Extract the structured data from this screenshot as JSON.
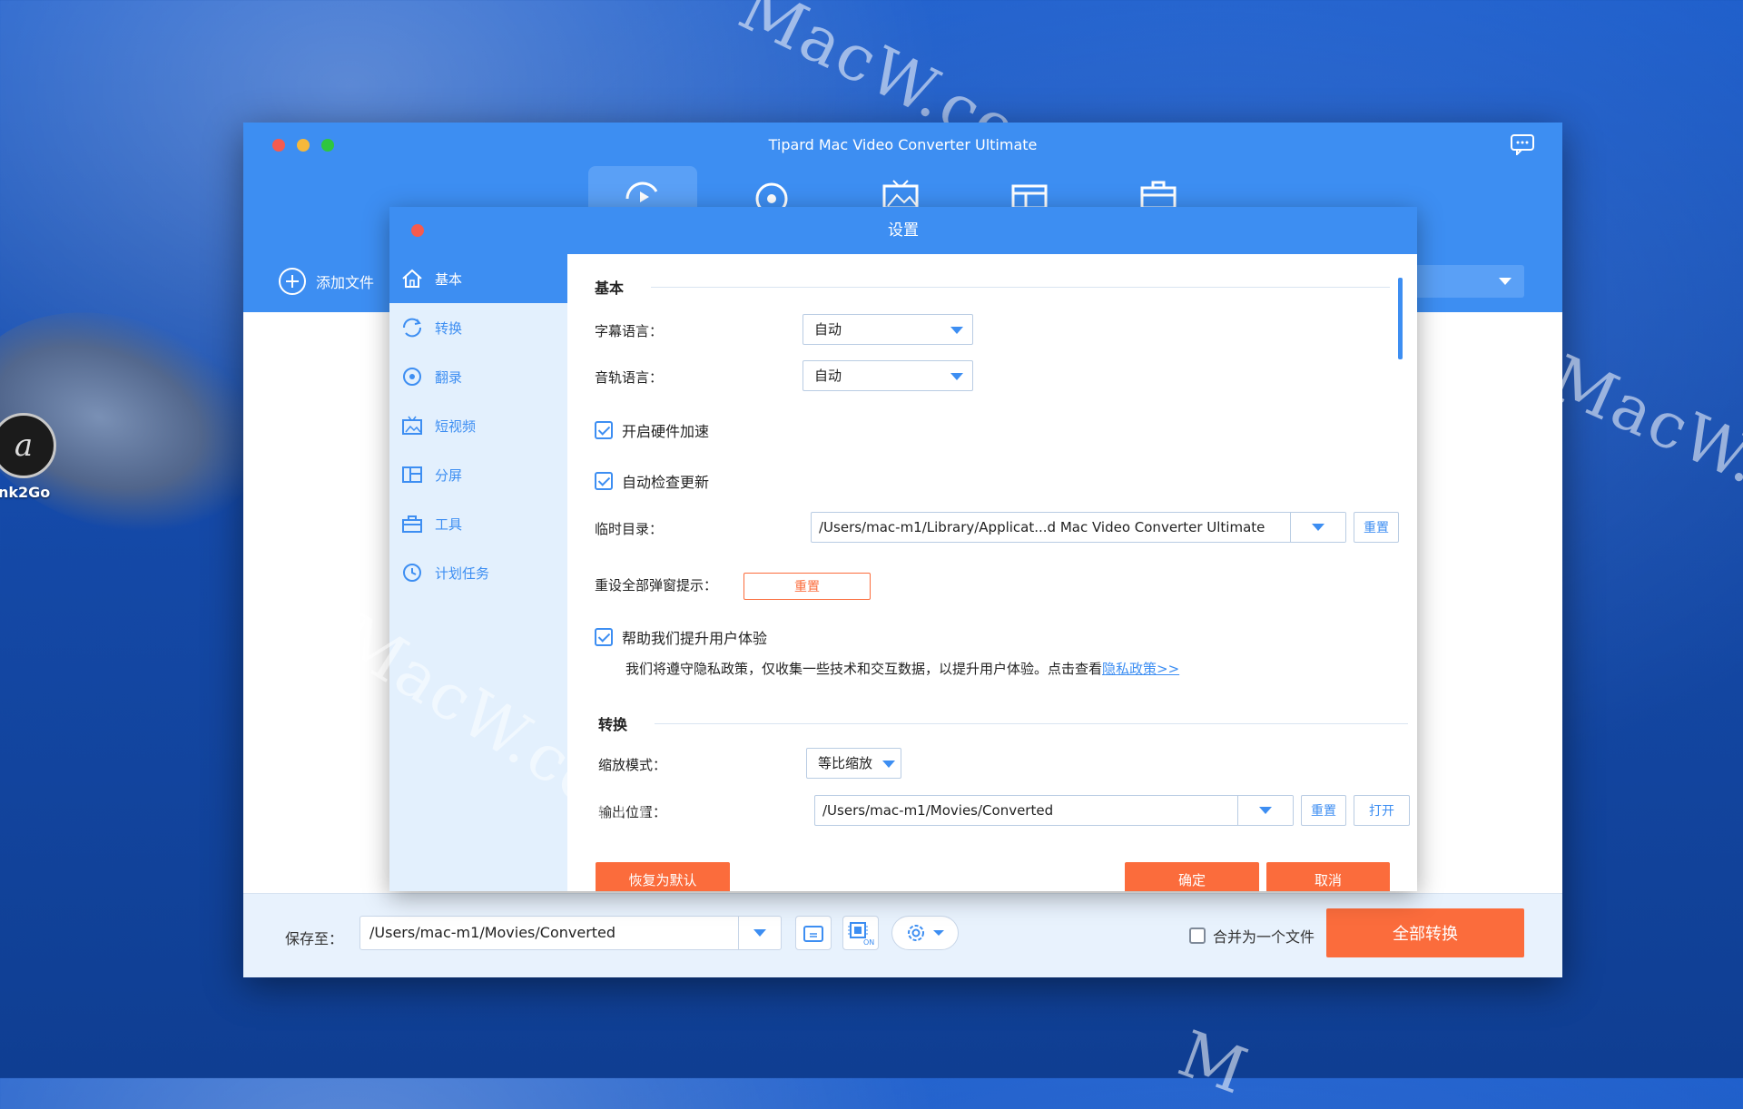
{
  "desktop": {
    "app_label": "nk2Go",
    "watermarks": [
      "MacW.com",
      "MacW.com",
      "MacW.c",
      "M"
    ]
  },
  "window": {
    "title": "Tipard Mac Video Converter Ultimate",
    "toolbar": {
      "add_file_label": "添加文件"
    },
    "bottom": {
      "save_to_label": "保存至：",
      "save_path": "/Users/mac-m1/Movies/Converted",
      "merge_label": "合并为一个文件",
      "convert_all_label": "全部转换"
    }
  },
  "dialog": {
    "title": "设置",
    "sidebar": [
      {
        "label": "基本",
        "icon": "home-icon",
        "active": true
      },
      {
        "label": "转换",
        "icon": "convert-icon",
        "active": false
      },
      {
        "label": "翻录",
        "icon": "disc-icon",
        "active": false
      },
      {
        "label": "短视频",
        "icon": "video-icon",
        "active": false
      },
      {
        "label": "分屏",
        "icon": "split-screen-icon",
        "active": false
      },
      {
        "label": "工具",
        "icon": "toolbox-icon",
        "active": false
      },
      {
        "label": "计划任务",
        "icon": "clock-icon",
        "active": false
      }
    ],
    "basic": {
      "section_title": "基本",
      "subtitle_lang_label": "字幕语言：",
      "subtitle_lang_value": "自动",
      "audio_lang_label": "音轨语言：",
      "audio_lang_value": "自动",
      "hw_accel_label": "开启硬件加速",
      "auto_update_label": "自动检查更新",
      "temp_dir_label": "临时目录：",
      "temp_dir_value": "/Users/mac-m1/Library/Applicat...d Mac Video Converter Ultimate",
      "reset_label": "重置",
      "reset_popups_label": "重设全部弹窗提示：",
      "reset_popups_button": "重置",
      "improve_label": "帮助我们提升用户体验",
      "privacy_text": "我们将遵守隐私政策，仅收集一些技术和交互数据，以提升用户体验。点击查看",
      "privacy_link": "隐私政策>>"
    },
    "convert": {
      "section_title": "转换",
      "zoom_mode_label": "缩放模式：",
      "zoom_mode_value": "等比缩放",
      "output_label": "输出位置：",
      "output_value": "/Users/mac-m1/Movies/Converted",
      "reset_label": "重置",
      "open_label": "打开"
    },
    "footer": {
      "restore_default": "恢复为默认",
      "ok": "确定",
      "cancel": "取消"
    }
  },
  "colors": {
    "accent_blue": "#3d8ef2",
    "accent_orange": "#fb6c3c",
    "sidebar_bg": "#e3f0fd"
  }
}
